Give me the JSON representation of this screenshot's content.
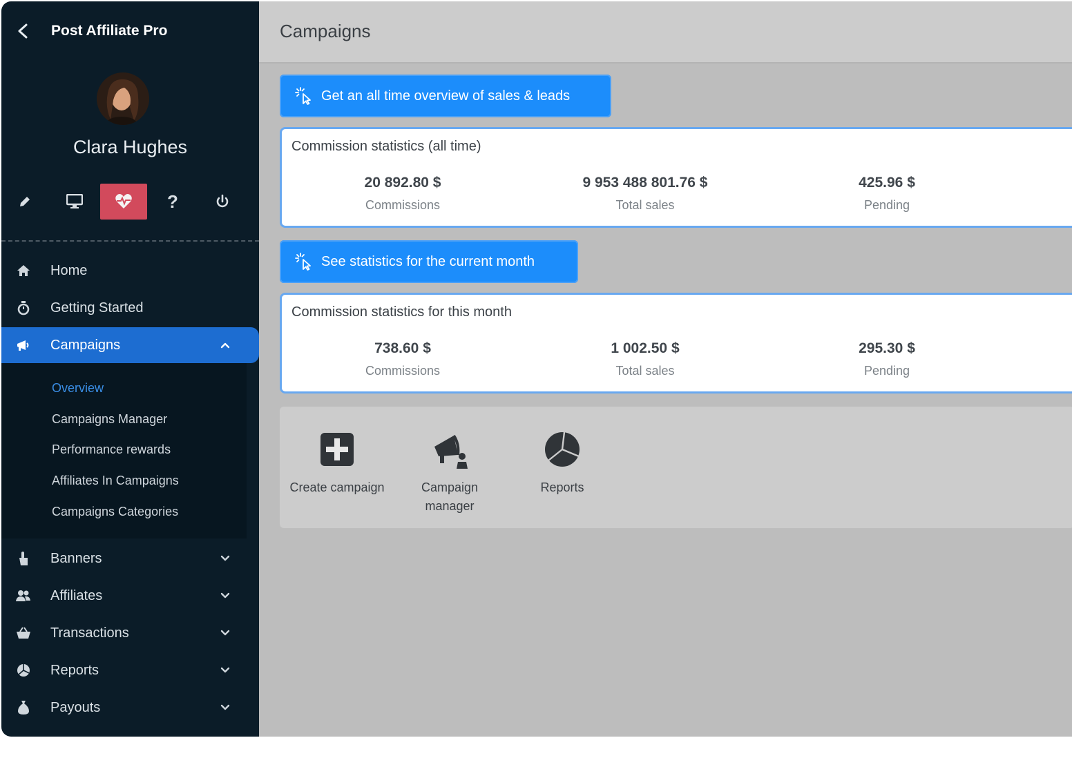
{
  "app": {
    "title": "Post Affiliate Pro"
  },
  "user": {
    "name": "Clara Hughes"
  },
  "toolbar": {
    "items": [
      {
        "icon": "pencil-icon"
      },
      {
        "icon": "monitor-icon"
      },
      {
        "icon": "heart-pulse-icon",
        "active": true
      },
      {
        "icon": "question-icon",
        "glyph": "?"
      },
      {
        "icon": "power-icon"
      }
    ]
  },
  "nav": {
    "home": "Home",
    "getting_started": "Getting Started",
    "campaigns": "Campaigns",
    "banners": "Banners",
    "affiliates": "Affiliates",
    "transactions": "Transactions",
    "reports": "Reports",
    "payouts": "Payouts"
  },
  "submenu": {
    "overview": "Overview",
    "campaigns_manager": "Campaigns Manager",
    "performance_rewards": "Performance rewards",
    "affiliates_in_campaigns": "Affiliates In Campaigns",
    "campaigns_categories": "Campaigns Categories"
  },
  "page": {
    "title": "Campaigns"
  },
  "buttons": {
    "all_time": "Get an all time overview of sales & leads",
    "current_month": "See statistics for the current month"
  },
  "all_time": {
    "title": "Commission statistics (all time)",
    "commissions_value": "20 892.80 $",
    "commissions_label": "Commissions",
    "total_sales_value": "9 953 488 801.76 $",
    "total_sales_label": "Total sales",
    "pending_value": "425.96 $",
    "pending_label": "Pending"
  },
  "this_month": {
    "title": "Commission statistics for this month",
    "commissions_value": "738.60 $",
    "commissions_label": "Commissions",
    "total_sales_value": "1 002.50 $",
    "total_sales_label": "Total sales",
    "pending_value": "295.30 $",
    "pending_label": "Pending"
  },
  "quick_links": {
    "create_campaign": "Create campaign",
    "campaign_manager_1": "Campaign",
    "campaign_manager_2": "manager",
    "reports": "Reports"
  },
  "colors": {
    "sidebar_bg": "#0b1c28",
    "accent_blue": "#1d6dd1",
    "button_blue": "#1c8dfb",
    "active_tool": "#d24a5c",
    "content_bg": "#bdbdbd"
  }
}
